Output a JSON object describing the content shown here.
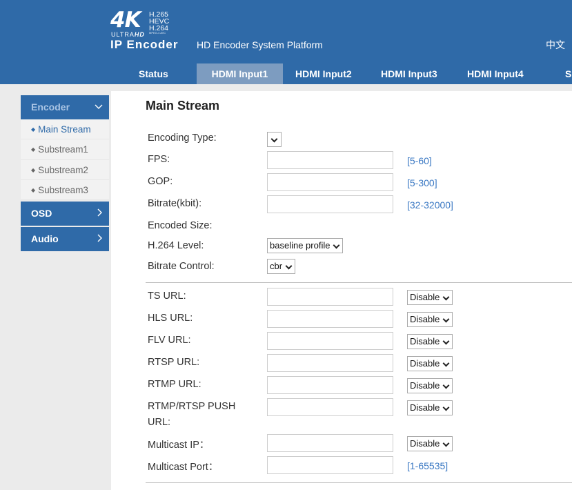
{
  "header": {
    "logo": {
      "big": "4K",
      "codecs": [
        "H.265",
        "HEVC",
        "H.264"
      ],
      "codec_note": "MPEG-4 AVC",
      "ultra": "ULTRA",
      "hd": "HD",
      "product": "IP Encoder"
    },
    "platform": "HD Encoder System Platform",
    "lang": "中文"
  },
  "nav": {
    "tabs": [
      "Status",
      "HDMI Input1",
      "HDMI Input2",
      "HDMI Input3",
      "HDMI Input4",
      "S"
    ],
    "active": "HDMI Input1"
  },
  "sidebar": {
    "encoder": {
      "label": "Encoder",
      "chevron": "chevron-down-icon"
    },
    "items": [
      "Main Stream",
      "Substream1",
      "Substream2",
      "Substream3"
    ],
    "active_item": "Main Stream",
    "osd": {
      "label": "OSD",
      "chevron": "chevron-right-icon"
    },
    "audio": {
      "label": "Audio",
      "chevron": "chevron-right-icon"
    }
  },
  "main": {
    "title": "Main Stream",
    "encoding_type": {
      "label": "Encoding Type:",
      "value": ""
    },
    "fps": {
      "label": "FPS:",
      "value": "",
      "range": "[5-60]"
    },
    "gop": {
      "label": "GOP:",
      "value": "",
      "range": "[5-300]"
    },
    "bitrate": {
      "label": "Bitrate(kbit):",
      "value": "",
      "range": "[32-32000]"
    },
    "encoded_size": {
      "label": "Encoded Size:"
    },
    "h264_level": {
      "label": "H.264 Level:",
      "value": "baseline profile"
    },
    "bitrate_control": {
      "label": "Bitrate Control:",
      "value": "cbr"
    },
    "urls": {
      "ts": {
        "label": "TS URL:",
        "value": "",
        "state": "Disable"
      },
      "hls": {
        "label": "HLS URL:",
        "value": "",
        "state": "Disable"
      },
      "flv": {
        "label": "FLV URL:",
        "value": "",
        "state": "Disable"
      },
      "rtsp": {
        "label": "RTSP URL:",
        "value": "",
        "state": "Disable"
      },
      "rtmp": {
        "label": "RTMP URL:",
        "value": "",
        "state": "Disable"
      },
      "push": {
        "label_line1": "RTMP/RTSP PUSH",
        "label_line2": "URL:",
        "value": "",
        "state": "Disable"
      }
    },
    "multicast_ip": {
      "label": "Multicast IP：",
      "value": "",
      "state": "Disable"
    },
    "multicast_port": {
      "label": "Multicast Port：",
      "value": "",
      "range": "[1-65535]"
    }
  },
  "colors": {
    "header": "#2f6aa8",
    "active_tab": "#7d9cc0",
    "range_text": "#3a78c3",
    "page_bg": "#ebebeb"
  }
}
